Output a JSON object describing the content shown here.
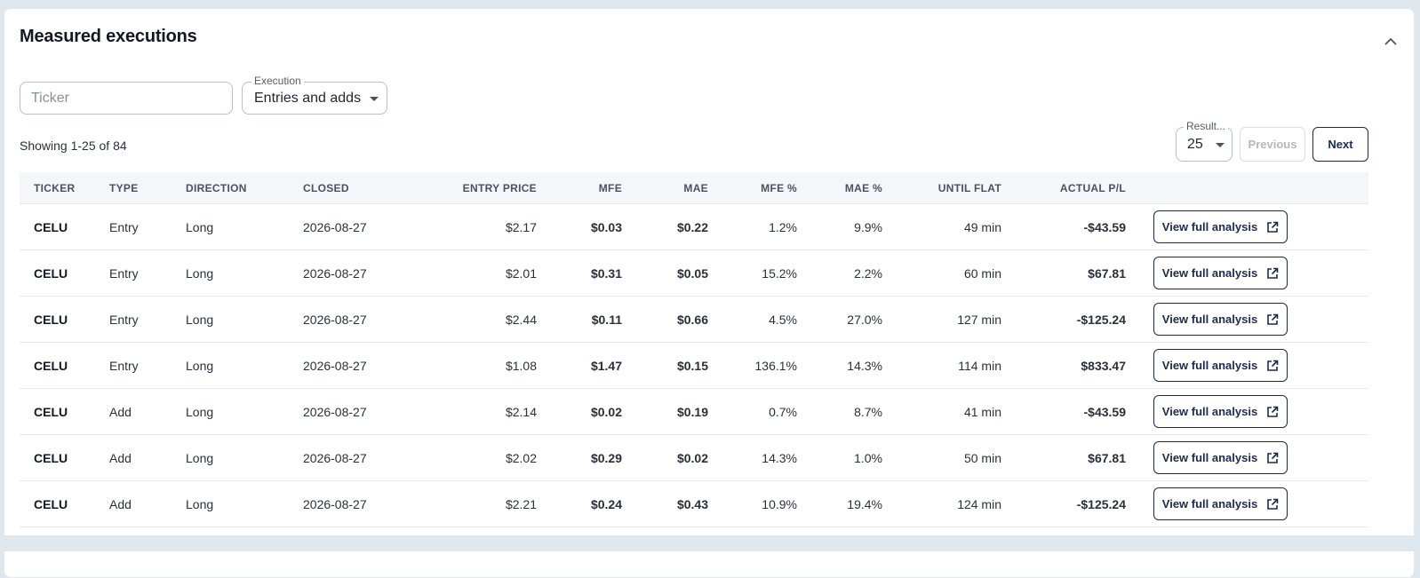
{
  "panel": {
    "title": "Measured executions"
  },
  "filters": {
    "ticker_placeholder": "Ticker",
    "ticker_value": "",
    "execution_label": "Execution",
    "execution_value": "Entries and adds"
  },
  "pagination": {
    "showing_text": "Showing 1-25 of 84",
    "results_label": "Result...",
    "results_value": "25",
    "previous_label": "Previous",
    "next_label": "Next"
  },
  "table": {
    "columns": [
      "TICKER",
      "TYPE",
      "DIRECTION",
      "CLOSED",
      "ENTRY PRICE",
      "MFE",
      "MAE",
      "MFE %",
      "MAE %",
      "UNTIL FLAT",
      "ACTUAL P/L"
    ],
    "action_label": "View full analysis",
    "rows": [
      {
        "ticker": "CELU",
        "type": "Entry",
        "direction": "Long",
        "closed": "2026-08-27",
        "entry_price": "$2.17",
        "mfe": "$0.03",
        "mae": "$0.22",
        "mfe_pct": "1.2%",
        "mae_pct": "9.9%",
        "until_flat": "49 min",
        "actual_pl": "-$43.59",
        "pl_sign": "neg"
      },
      {
        "ticker": "CELU",
        "type": "Entry",
        "direction": "Long",
        "closed": "2026-08-27",
        "entry_price": "$2.01",
        "mfe": "$0.31",
        "mae": "$0.05",
        "mfe_pct": "15.2%",
        "mae_pct": "2.2%",
        "until_flat": "60 min",
        "actual_pl": "$67.81",
        "pl_sign": "pos"
      },
      {
        "ticker": "CELU",
        "type": "Entry",
        "direction": "Long",
        "closed": "2026-08-27",
        "entry_price": "$2.44",
        "mfe": "$0.11",
        "mae": "$0.66",
        "mfe_pct": "4.5%",
        "mae_pct": "27.0%",
        "until_flat": "127 min",
        "actual_pl": "-$125.24",
        "pl_sign": "neg"
      },
      {
        "ticker": "CELU",
        "type": "Entry",
        "direction": "Long",
        "closed": "2026-08-27",
        "entry_price": "$1.08",
        "mfe": "$1.47",
        "mae": "$0.15",
        "mfe_pct": "136.1%",
        "mae_pct": "14.3%",
        "until_flat": "114 min",
        "actual_pl": "$833.47",
        "pl_sign": "pos"
      },
      {
        "ticker": "CELU",
        "type": "Add",
        "direction": "Long",
        "closed": "2026-08-27",
        "entry_price": "$2.14",
        "mfe": "$0.02",
        "mae": "$0.19",
        "mfe_pct": "0.7%",
        "mae_pct": "8.7%",
        "until_flat": "41 min",
        "actual_pl": "-$43.59",
        "pl_sign": "neg"
      },
      {
        "ticker": "CELU",
        "type": "Add",
        "direction": "Long",
        "closed": "2026-08-27",
        "entry_price": "$2.02",
        "mfe": "$0.29",
        "mae": "$0.02",
        "mfe_pct": "14.3%",
        "mae_pct": "1.0%",
        "until_flat": "50 min",
        "actual_pl": "$67.81",
        "pl_sign": "pos"
      },
      {
        "ticker": "CELU",
        "type": "Add",
        "direction": "Long",
        "closed": "2026-08-27",
        "entry_price": "$2.21",
        "mfe": "$0.24",
        "mae": "$0.43",
        "mfe_pct": "10.9%",
        "mae_pct": "19.4%",
        "until_flat": "124 min",
        "actual_pl": "-$125.24",
        "pl_sign": "neg"
      }
    ]
  },
  "colors": {
    "positive": "#1f7a2e",
    "negative": "#b42323",
    "accent": "#1b2b4f"
  },
  "icons": {
    "collapse": "chevron-up-icon",
    "dropdown": "caret-down-icon",
    "external": "external-link-icon"
  }
}
